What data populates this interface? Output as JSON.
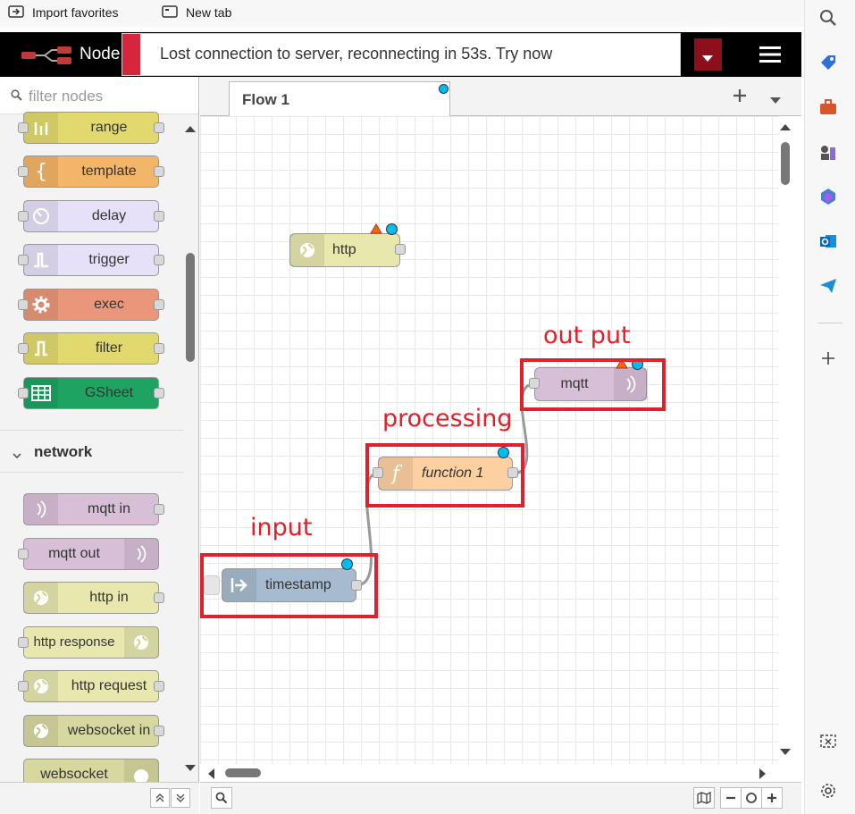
{
  "browser": {
    "favorites": [
      {
        "label": "Import favorites",
        "icon": "import-favorites-icon"
      },
      {
        "label": "New tab",
        "icon": "new-tab-icon"
      }
    ],
    "sidebar_icons": [
      "search-icon",
      "tag-icon",
      "toolbox-icon",
      "chess-icon",
      "copilot-icon",
      "outlook-icon",
      "send-icon",
      "add-icon",
      "screenshot-icon",
      "settings-icon"
    ]
  },
  "header": {
    "title": "Node"
  },
  "notification": {
    "text": "Lost connection to server, reconnecting in 53s. Try now"
  },
  "palette": {
    "filter_placeholder": "filter nodes",
    "function_nodes": [
      {
        "label": "range",
        "color": "#e2d96e"
      },
      {
        "label": "template",
        "color": "#f3b567"
      },
      {
        "label": "delay",
        "color": "#e6e0f8"
      },
      {
        "label": "trigger",
        "color": "#e6e0f8"
      },
      {
        "label": "exec",
        "color": "#e9967a"
      },
      {
        "label": "filter",
        "color": "#e2d96e"
      },
      {
        "label": "GSheet",
        "color": "#1ea362"
      }
    ],
    "network_category": "network",
    "network_nodes": [
      {
        "label": "mqtt in",
        "color": "#d8bfd8"
      },
      {
        "label": "mqtt out",
        "color": "#d8bfd8"
      },
      {
        "label": "http in",
        "color": "#e7e7ae"
      },
      {
        "label": "http response",
        "color": "#e7e7ae"
      },
      {
        "label": "http request",
        "color": "#e7e7ae"
      },
      {
        "label": "websocket in",
        "color": "#d7d7a0"
      },
      {
        "label": "websocket",
        "color": "#d7d7a0"
      }
    ]
  },
  "workspace": {
    "tab": "Flow 1",
    "nodes": {
      "http": "http",
      "mqtt": "mqtt",
      "function": "function 1",
      "timestamp": "timestamp"
    },
    "annotations": {
      "output": "out put",
      "processing": "processing",
      "input": "input"
    }
  },
  "colors": {
    "accent_red": "#e0202a",
    "changed_dot": "#00bcf2",
    "deploy": "#8c101c"
  }
}
